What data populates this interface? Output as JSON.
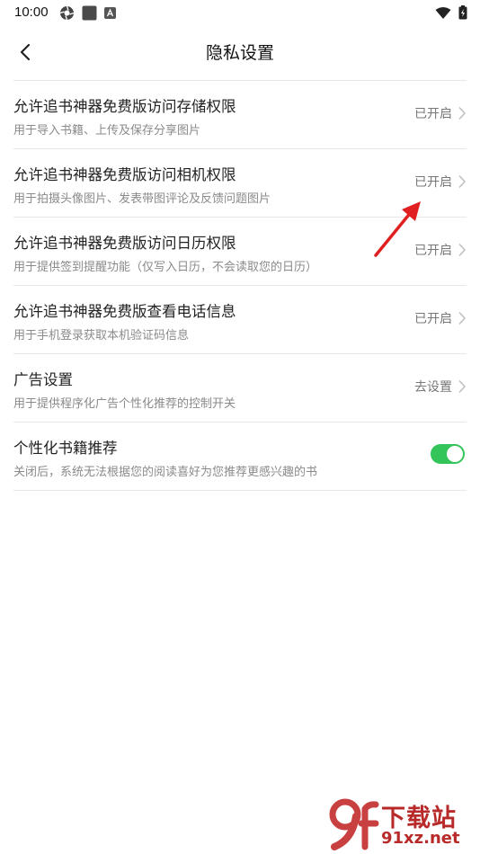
{
  "status_bar": {
    "time": "10:00"
  },
  "header": {
    "title": "隐私设置"
  },
  "settings": [
    {
      "title": "允许追书神器免费版访问存储权限",
      "desc": "用于导入书籍、上传及保存分享图片",
      "status": "已开启"
    },
    {
      "title": "允许追书神器免费版访问相机权限",
      "desc": "用于拍摄头像图片、发表带图评论及反馈问题图片",
      "status": "已开启"
    },
    {
      "title": "允许追书神器免费版访问日历权限",
      "desc": "用于提供签到提醒功能（仅写入日历，不会读取您的日历）",
      "status": "已开启"
    },
    {
      "title": "允许追书神器免费版查看电话信息",
      "desc": "用于手机登录获取本机验证码信息",
      "status": "已开启"
    },
    {
      "title": "广告设置",
      "desc": "用于提供程序化广告个性化推荐的控制开关",
      "status": "去设置"
    }
  ],
  "recommend": {
    "title": "个性化书籍推荐",
    "desc": "关闭后，系统无法根据您的阅读喜好为您推荐更感兴趣的书",
    "enabled": true
  },
  "watermark": {
    "brand": "下载站",
    "site": "91xz.net",
    "logo": "9f"
  },
  "colors": {
    "toggle_on": "#33c45a",
    "annotation_arrow": "#e02020",
    "watermark": "#b82a2a"
  }
}
